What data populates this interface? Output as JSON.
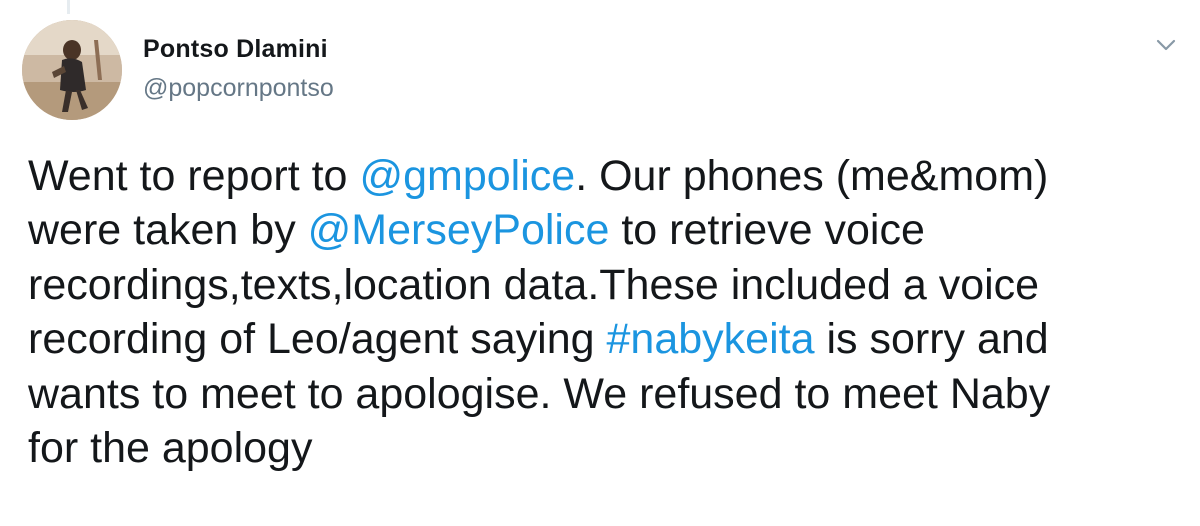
{
  "user": {
    "display_name": "Pontso Dlamini",
    "handle": "@popcornpontso"
  },
  "icons": {
    "menu": "chevron-down-icon",
    "avatar": "profile-photo"
  },
  "colors": {
    "link": "#1b95e0",
    "text": "#14171a",
    "secondary": "#657786"
  },
  "tweet": {
    "lines": [
      {
        "t1": "Went to report to ",
        "link1": "@gmpolice",
        "t2": ". Our phones (me&mom)"
      },
      {
        "t1": "were taken by ",
        "link1": "@MerseyPolice",
        "t2": " to retrieve voice"
      },
      {
        "t1": "recordings,texts,location data.These included a voice"
      },
      {
        "t1": "recording of Leo/agent saying ",
        "link1": "#nabykeita",
        "t2": " is sorry and"
      },
      {
        "t1": "wants to meet to apologise. We refused to meet Naby"
      },
      {
        "t1": "for the apology"
      }
    ]
  }
}
